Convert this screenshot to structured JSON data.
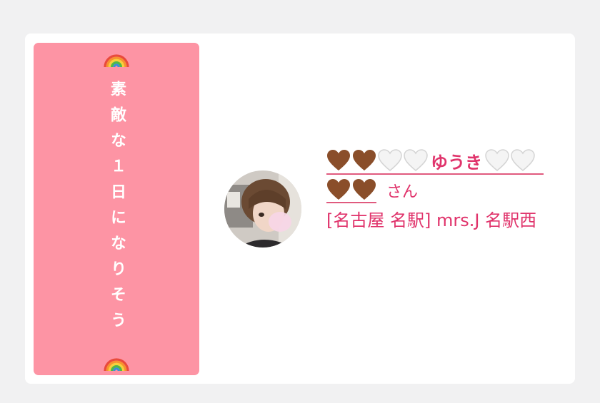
{
  "banner": {
    "top_emoji": "rainbow-icon",
    "text": "素敵な１日になりそう",
    "bottom_emoji": "rainbow-icon",
    "background_color": "#fd94a4"
  },
  "profile": {
    "avatar_icon": "avatar-photo",
    "name_prefix_hearts": [
      "brown-heart-icon",
      "brown-heart-icon",
      "white-heart-icon",
      "white-heart-icon"
    ],
    "name": "ゆうき",
    "name_suffix_hearts": [
      "white-heart-icon",
      "white-heart-icon",
      "brown-heart-icon",
      "brown-heart-icon"
    ],
    "honorific": "さん",
    "shop": "[名古屋 名駅] mrs.J 名駅西",
    "accent_color": "#e0336b"
  }
}
